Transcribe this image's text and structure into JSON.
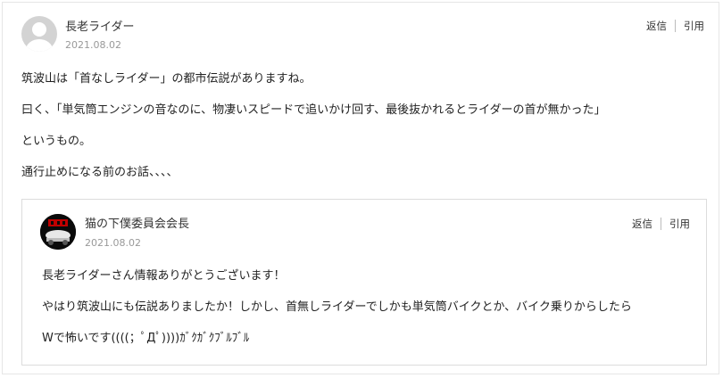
{
  "comment": {
    "author": "長老ライダー",
    "date": "2021.08.02",
    "actions": {
      "reply": "返信",
      "quote": "引用"
    },
    "paragraphs": [
      "筑波山は「首なしライダー」の都市伝説がありますね。",
      "曰く、「単気筒エンジンの音なのに、物凄いスピードで追いかけ回す、最後抜かれるとライダーの首が無かった」",
      "というもの。",
      "通行止めになる前のお話、、、、"
    ]
  },
  "reply": {
    "author": "猫の下僕委員会会長",
    "date": "2021.08.02",
    "actions": {
      "reply": "返信",
      "quote": "引用"
    },
    "paragraphs": [
      "長老ライダーさん情報ありがとうございます！",
      "やはり筑波山にも伝説ありましたか！しかし、首無しライダーでしかも単気筒バイクとか、バイク乗りからしたら",
      "Wで怖いです((((；ﾟДﾟ))))ｶﾞｸｶﾞｸﾌﾞﾙﾌﾞﾙ"
    ]
  },
  "colors": {
    "accent_red": "#c00000",
    "muted": "#999999"
  }
}
